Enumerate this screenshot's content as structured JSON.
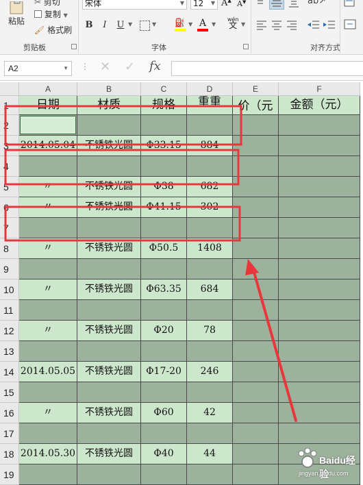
{
  "ribbon": {
    "clipboard": {
      "paste_label": "粘贴",
      "cut_label": "剪切",
      "copy_label": "复制",
      "format_painter_label": "格式刷",
      "group_title": "剪贴板"
    },
    "font": {
      "font_name": "宋体",
      "font_size": "12",
      "grow_glyph": "A",
      "shrink_glyph": "A",
      "bold": "B",
      "italic": "I",
      "underline": "U",
      "pinyin_label": "wén",
      "group_title": "字体",
      "fill_color": "#ffff00",
      "font_color": "#ff0000"
    },
    "alignment": {
      "group_title": "对齐方式"
    }
  },
  "formula_bar": {
    "name_box": "A2",
    "fx_label": "fx",
    "cancel_glyph": "✕",
    "enter_glyph": "✓"
  },
  "sheet": {
    "columns": [
      "A",
      "B",
      "C",
      "D",
      "E",
      "F"
    ],
    "header": [
      "日期",
      "材质",
      "规格",
      "重量(公",
      "单价(元",
      "金额(元)"
    ],
    "header_display": [
      "日期",
      "材质",
      "规格",
      "重重",
      "价（元",
      "金额（元）"
    ],
    "rows": [
      {
        "num": "1",
        "type": "header"
      },
      {
        "num": "2",
        "type": "blank",
        "cells": [
          "",
          "",
          "",
          ""
        ]
      },
      {
        "num": "3",
        "type": "data",
        "cells": [
          "2014.05.04",
          "不锈铁光圆",
          "Φ33.15",
          "884"
        ]
      },
      {
        "num": "4",
        "type": "blank",
        "cells": [
          "",
          "",
          "",
          ""
        ]
      },
      {
        "num": "5",
        "type": "data",
        "cells": [
          "〃",
          "不锈铁光圆",
          "Φ38",
          "682"
        ]
      },
      {
        "num": "6",
        "type": "data",
        "cells": [
          "〃",
          "不锈铁光圆",
          "Φ41.15",
          "302"
        ]
      },
      {
        "num": "7",
        "type": "blank",
        "cells": [
          "",
          "",
          "",
          ""
        ]
      },
      {
        "num": "8",
        "type": "data",
        "cells": [
          "〃",
          "不锈铁光圆",
          "Φ50.5",
          "1408"
        ]
      },
      {
        "num": "9",
        "type": "blank",
        "cells": [
          "",
          "",
          "",
          ""
        ]
      },
      {
        "num": "10",
        "type": "data",
        "cells": [
          "〃",
          "不锈铁光圆",
          "Φ63.35",
          "684"
        ]
      },
      {
        "num": "11",
        "type": "blank",
        "cells": [
          "",
          "",
          "",
          ""
        ]
      },
      {
        "num": "12",
        "type": "data",
        "cells": [
          "〃",
          "不锈铁光圆",
          "Φ20",
          "78"
        ]
      },
      {
        "num": "13",
        "type": "blank",
        "cells": [
          "",
          "",
          "",
          ""
        ]
      },
      {
        "num": "14",
        "type": "data",
        "cells": [
          "2014.05.05",
          "不锈铁光圆",
          "Φ17-20",
          "246"
        ]
      },
      {
        "num": "15",
        "type": "blank",
        "cells": [
          "",
          "",
          "",
          ""
        ]
      },
      {
        "num": "16",
        "type": "data",
        "cells": [
          "〃",
          "不锈铁光圆",
          "Φ60",
          "42"
        ]
      },
      {
        "num": "17",
        "type": "blank",
        "cells": [
          "",
          "",
          "",
          ""
        ]
      },
      {
        "num": "18",
        "type": "data",
        "cells": [
          "2014.05.30",
          "不锈铁光圆",
          "Φ40",
          "44"
        ]
      },
      {
        "num": "19",
        "type": "blank",
        "cells": [
          "",
          "",
          "",
          ""
        ]
      }
    ]
  },
  "watermark": {
    "brand": "Baidu经验",
    "url": "jingyan.baidu.com"
  },
  "colors": {
    "cell_light": "#cde7cd",
    "cell_dark": "#9cb29c",
    "annotation_red": "#e8373c"
  }
}
